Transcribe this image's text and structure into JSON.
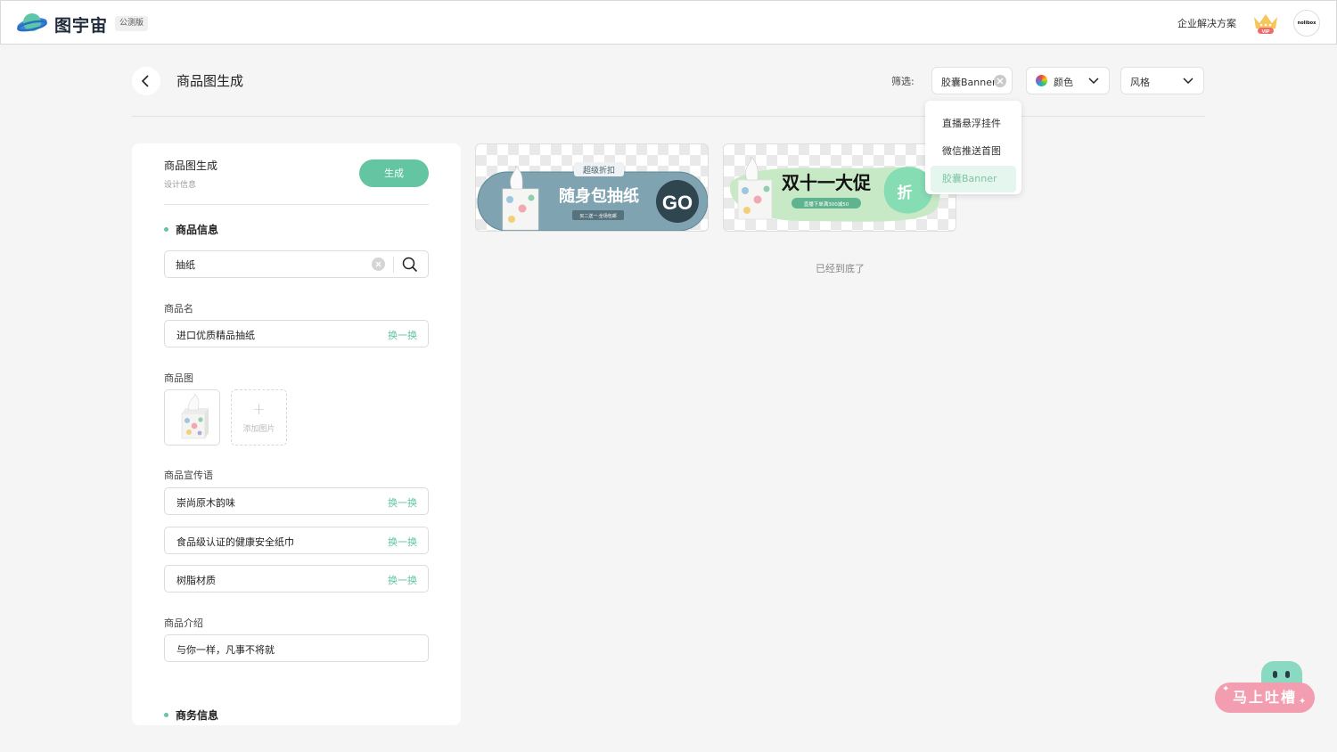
{
  "header": {
    "brand": "图宇宙",
    "beta_badge": "公测版",
    "enterprise_link": "企业解决方案",
    "vip_label": "VIP",
    "avatar_text": "nolibox"
  },
  "page": {
    "title": "商品图生成",
    "filter_label": "筛选:",
    "filter_selected": "胶囊Banner",
    "filter_color": "颜色",
    "filter_style": "风格",
    "dropdown_options": [
      "直播悬浮挂件",
      "微信推送首图",
      "胶囊Banner"
    ],
    "dropdown_active_index": 2,
    "end_text": "已经到底了"
  },
  "form": {
    "title": "商品图生成",
    "subtitle": "设计信息",
    "generate_label": "生成",
    "product_info_heading": "商品信息",
    "search_value": "抽纸",
    "name_label": "商品名",
    "name_value": "进口优质精品抽纸",
    "swap_label": "换一换",
    "image_label": "商品图",
    "add_image_label": "添加图片",
    "slogan_label": "商品宣传语",
    "slogans": [
      "崇尚原木韵味",
      "食品级认证的健康安全纸巾",
      "树脂材质"
    ],
    "intro_label": "商品介绍",
    "intro_value": "与你一样，凡事不将就",
    "business_heading": "商务信息"
  },
  "cards": [
    {
      "top_text": "超级折扣",
      "main_text": "随身包抽纸",
      "sub_text": "买二送一·全场包邮",
      "cta": "GO",
      "colors": {
        "band": "#7fa3b0",
        "band_dark": "#5e8795"
      }
    },
    {
      "main_text": "双十一大促",
      "sub_text": "直播下单满300减50",
      "badge": "折",
      "colors": {
        "band": "#c8e9c6",
        "badge": "#86dcb3"
      }
    }
  ],
  "feedback": {
    "label": "马上吐槽"
  },
  "colors": {
    "accent": "#63c5a2",
    "accent_light": "#e5f6ef",
    "feedback_pink": "#f29db0"
  }
}
